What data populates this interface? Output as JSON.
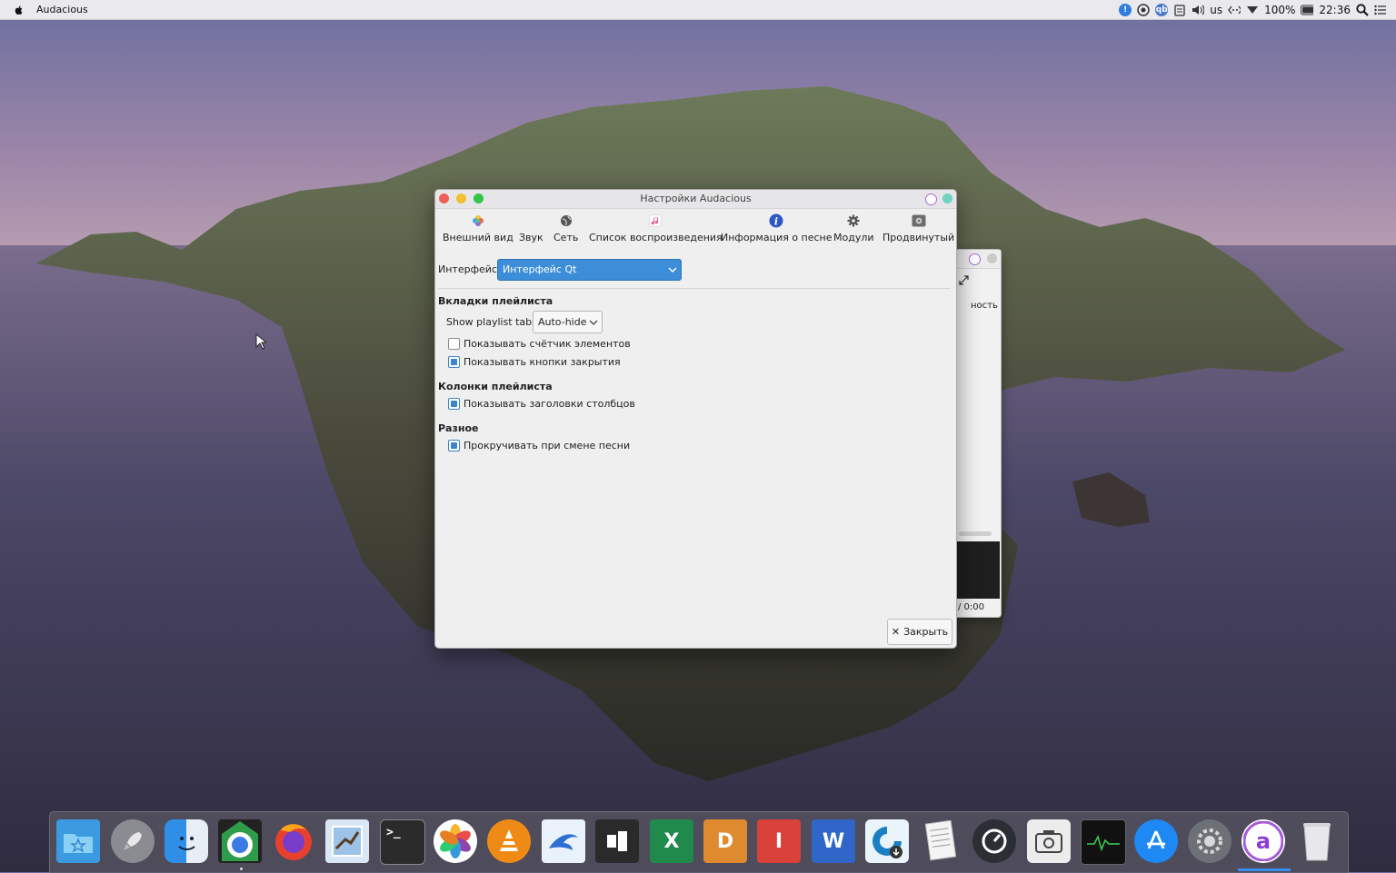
{
  "menubar": {
    "app_name": "Audacious",
    "tray": {
      "keyboard": "us",
      "battery": "100%",
      "clock": "22:36"
    }
  },
  "dialog": {
    "title": "Настройки Audacious",
    "tabs": [
      {
        "label": "Внешний вид",
        "icon": "appearance-icon"
      },
      {
        "label": "Звук",
        "icon": "audio-icon"
      },
      {
        "label": "Сеть",
        "icon": "network-icon"
      },
      {
        "label": "Список воспроизведения",
        "icon": "playlist-icon"
      },
      {
        "label": "Информация о песне",
        "icon": "info-icon"
      },
      {
        "label": "Модули",
        "icon": "plugins-icon"
      },
      {
        "label": "Продвинутый",
        "icon": "advanced-icon"
      }
    ],
    "interface_label": "Интерфейс:",
    "interface_value": "Интерфейс Qt",
    "section_tabs": "Вкладки плейлиста",
    "show_tabs_label": "Show playlist tabs:",
    "show_tabs_value": "Auto-hide",
    "cb_counter": {
      "label": "Показывать счётчик элементов",
      "checked": false
    },
    "cb_close": {
      "label": "Показывать кнопки закрытия",
      "checked": true
    },
    "section_columns": "Колонки плейлиста",
    "cb_headers": {
      "label": "Показывать заголовки столбцов",
      "checked": true
    },
    "section_misc": "Разное",
    "cb_scroll": {
      "label": "Прокручивать при смене песни",
      "checked": true
    },
    "close_button": "Закрыть"
  },
  "back_window": {
    "partial_label": "ность",
    "time": "/ 0:00"
  },
  "dock": [
    "finder-stack-icon",
    "launchpad-icon",
    "finder-icon",
    "chrome-icon",
    "firefox-icon",
    "mail-icon",
    "terminal-icon",
    "photos-icon",
    "vlc-icon",
    "dolphin-icon",
    "notes-icon",
    "excel-icon",
    "docs-icon",
    "impress-icon",
    "word-icon",
    "torrent-icon",
    "text-editor-icon",
    "timer-icon",
    "screenshot-icon",
    "monitor-icon",
    "app-store-icon",
    "settings-icon",
    "audacious-icon",
    "trash-icon"
  ]
}
